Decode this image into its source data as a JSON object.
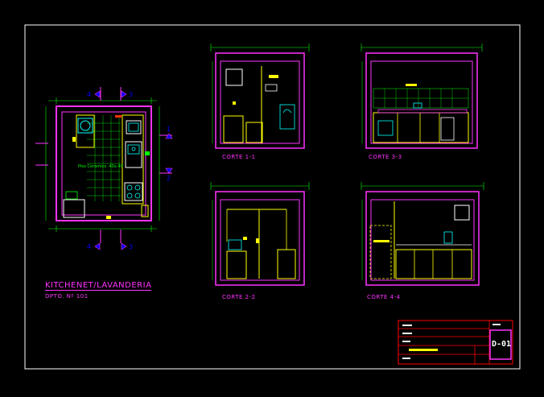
{
  "drawing": {
    "title": "KITCHENET/LAVANDERIA",
    "subtitle": "DPTO. Nº 101",
    "floor_label": "Piso Ceramico .40x.40"
  },
  "sections": {
    "c11": "CORTE 1-1",
    "c22": "CORTE 2-2",
    "c33": "CORTE 3-3",
    "c44": "CORTE 4-4"
  },
  "section_marks": {
    "n1": "1",
    "n2": "2",
    "n3": "3",
    "n4": "4"
  },
  "title_block": {
    "sheet_number": "D-01"
  },
  "colors": {
    "background": "#000000",
    "border": "#ffffff",
    "walls": "#ff33ff",
    "fixtures": "#ffff00",
    "dimensions": "#00ff00",
    "text_magenta": "#ff33ff",
    "titleblock": "#ff0000",
    "annotation_cyan": "#00ffff"
  }
}
